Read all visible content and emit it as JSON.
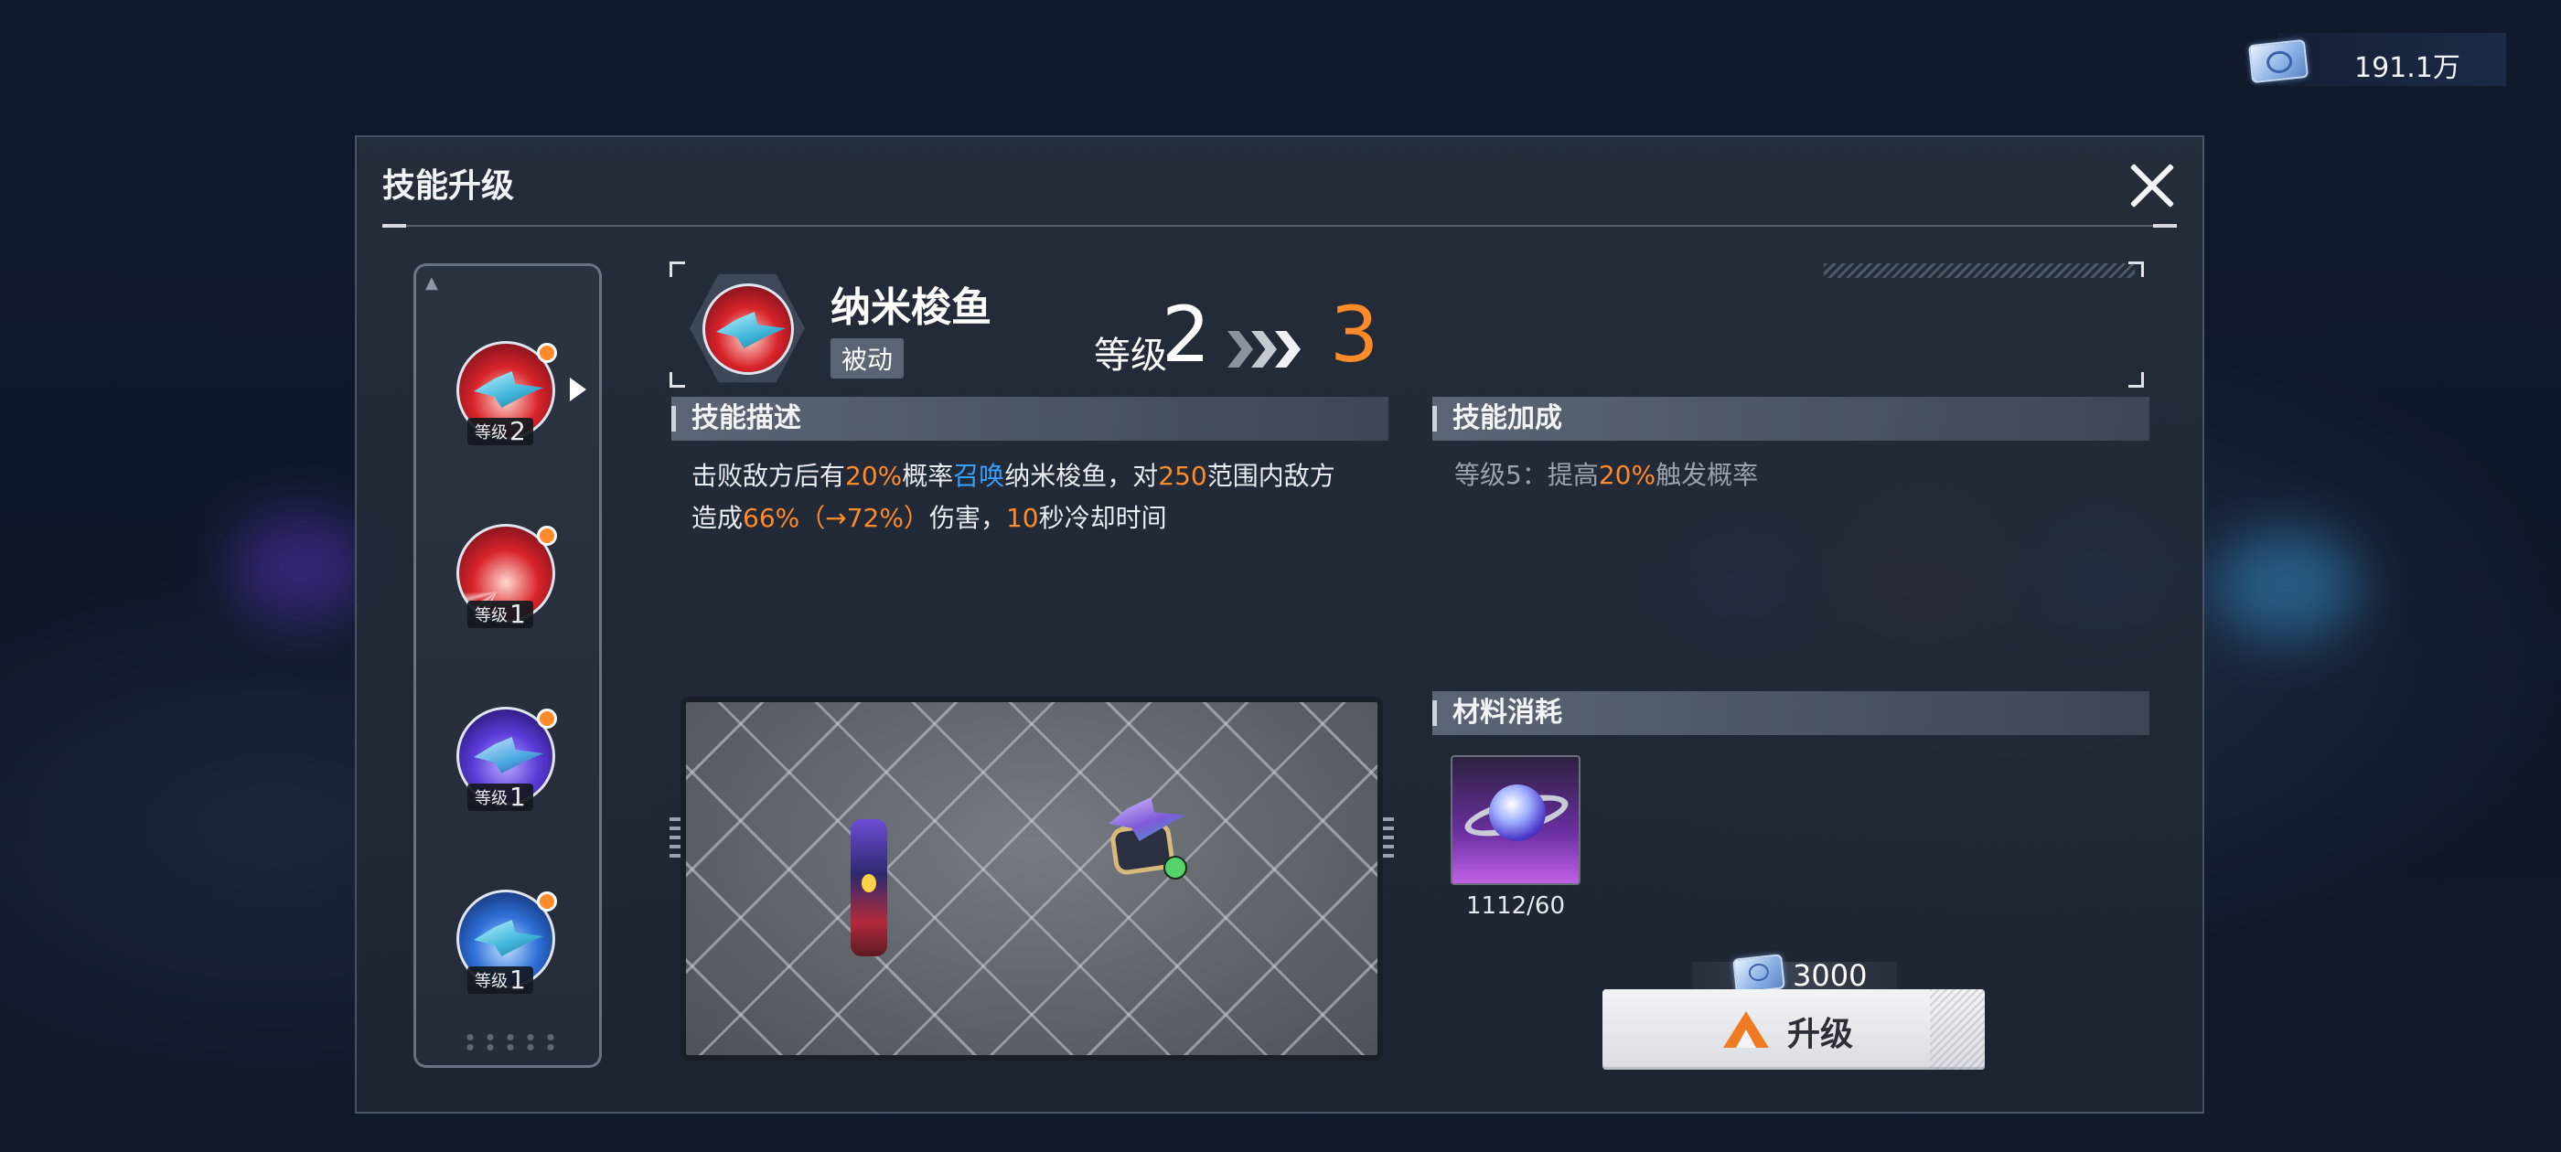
{
  "currency": {
    "value": "191.1万"
  },
  "modal": {
    "title": "技能升级"
  },
  "skills": [
    {
      "level_prefix": "等级",
      "level": "2",
      "theme": "red-fish",
      "selected": true
    },
    {
      "level_prefix": "等级",
      "level": "1",
      "theme": "red-beam",
      "selected": false
    },
    {
      "level_prefix": "等级",
      "level": "1",
      "theme": "purple-fish",
      "selected": false
    },
    {
      "level_prefix": "等级",
      "level": "1",
      "theme": "blue-fish",
      "selected": false
    }
  ],
  "header": {
    "name": "纳米梭鱼",
    "type_tag": "被动",
    "level_label": "等级",
    "level_from": "2",
    "level_to": "3"
  },
  "description": {
    "title": "技能描述",
    "p1": "击败敌方后有",
    "v1": "20%",
    "p2": "概率",
    "summon": "召唤",
    "p3": "纳米梭鱼，对",
    "v2": "250",
    "p4": "范围内敌方",
    "p5": "造成",
    "v3": "66%（→72%）",
    "p6": "伤害，",
    "v4": "10",
    "p7": "秒冷却时间"
  },
  "bonus": {
    "title": "技能加成",
    "p1": "等级5：提高",
    "v1": "20%",
    "p2": "触发概率"
  },
  "materials": {
    "title": "材料消耗",
    "item_count": "1112/60"
  },
  "cost": {
    "value": "3000"
  },
  "upgrade_button": {
    "label": "升级"
  },
  "colors": {
    "accent": "#ff8a2a",
    "highlight_blue": "#3aa0ff"
  }
}
